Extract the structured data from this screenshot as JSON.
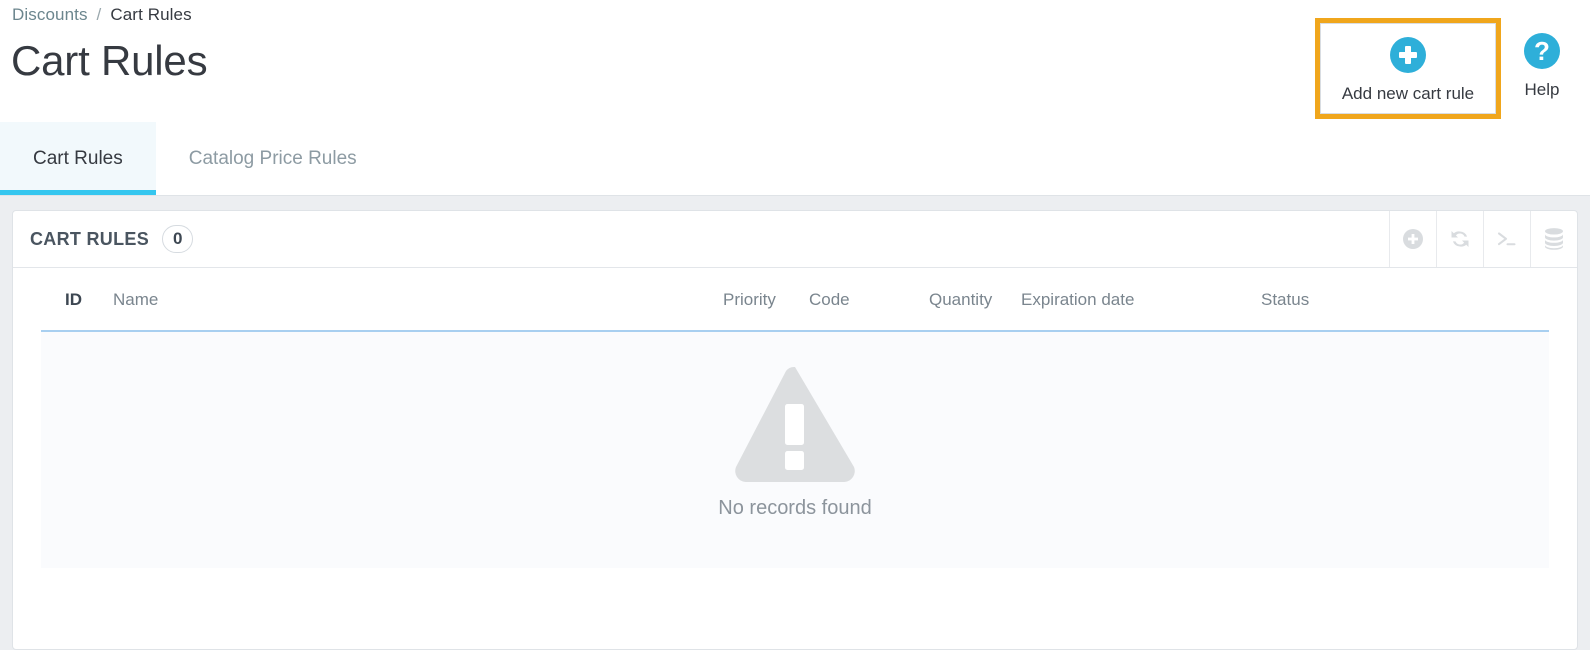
{
  "breadcrumb": {
    "parent": "Discounts",
    "separator": "/",
    "current": "Cart Rules"
  },
  "page": {
    "title": "Cart Rules"
  },
  "header_actions": {
    "add_rule": {
      "label": "Add new cart rule",
      "icon": "plus-circle-icon",
      "highlighted": true,
      "highlight_color": "#f0a61c"
    },
    "help": {
      "label": "Help",
      "icon": "question-circle-icon"
    },
    "accent_color": "#2eafd9"
  },
  "tabs": [
    {
      "label": "Cart Rules",
      "active": true
    },
    {
      "label": "Catalog Price Rules",
      "active": false
    }
  ],
  "panel": {
    "title": "CART RULES",
    "count": "0",
    "tools": [
      {
        "name": "add-icon",
        "title": "Add"
      },
      {
        "name": "refresh-icon",
        "title": "Refresh"
      },
      {
        "name": "terminal-icon",
        "title": "Console"
      },
      {
        "name": "database-icon",
        "title": "SQL manager"
      }
    ]
  },
  "table": {
    "columns": [
      "ID",
      "Name",
      "Priority",
      "Code",
      "Quantity",
      "Expiration date",
      "Status"
    ],
    "rows": [],
    "empty_message": "No records found",
    "empty_icon": "warning-triangle-icon"
  }
}
